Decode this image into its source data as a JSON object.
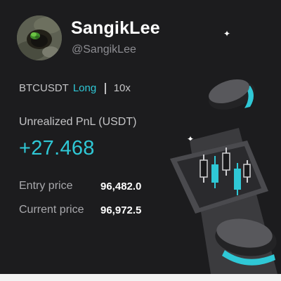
{
  "profile": {
    "name": "SangikLee",
    "handle": "@SangikLee"
  },
  "trade": {
    "pair": "BTCUSDT",
    "side": "Long",
    "leverage": "10x"
  },
  "pnl": {
    "label": "Unrealized PnL (USDT)",
    "value": "+27.468"
  },
  "prices": {
    "entry_label": "Entry price",
    "entry_value": "96,482.0",
    "current_label": "Current price",
    "current_value": "96,972.5"
  },
  "icons": {
    "sparkle": "✦"
  },
  "colors": {
    "accent": "#2fc8d6",
    "background": "#1c1c1e"
  }
}
